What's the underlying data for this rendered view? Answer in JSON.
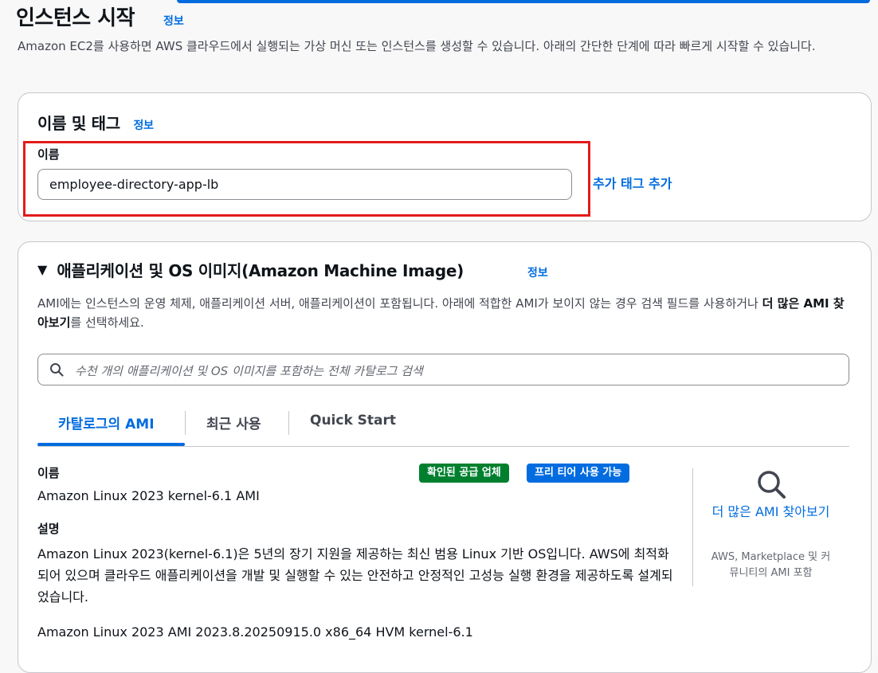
{
  "page": {
    "title": "인스턴스 시작",
    "info": "정보",
    "description": "Amazon EC2를 사용하면 AWS 클라우드에서 실행되는 가상 머신 또는 인스턴스를 생성할 수 있습니다. 아래의 간단한 단계에 따라 빠르게 시작할 수 있습니다."
  },
  "name_tags": {
    "heading": "이름 및 태그",
    "info": "정보",
    "name_label": "이름",
    "name_value": "employee-directory-app-lb",
    "add_tags": "추가 태그 추가"
  },
  "ami": {
    "heading": "애플리케이션 및 OS 이미지(Amazon Machine Image)",
    "info": "정보",
    "desc_part1": "AMI에는 인스턴스의 운영 체제, 애플리케이션 서버, 애플리케이션이 포함됩니다. 아래에 적합한 AMI가 보이지 않는 경우 검색 필드를 사용하거나 ",
    "desc_bold": "더 많은 AMI 찾아보기",
    "desc_part2": "를 선택하세요.",
    "search_placeholder": "수천 개의 애플리케이션 및 OS 이미지를 포함하는 전체 카탈로그 검색",
    "tabs": [
      "카탈로그의 AMI",
      "최근 사용",
      "Quick Start"
    ],
    "name_label": "이름",
    "name_value": "Amazon Linux 2023 kernel-6.1 AMI",
    "badges": [
      "확인된 공급 업체",
      "프리 티어 사용 가능"
    ],
    "desc_label": "설명",
    "desc_value": "Amazon Linux 2023(kernel-6.1)은 5년의 장기 지원을 제공하는 최신 범용 Linux 기반 OS입니다. AWS에 최적화되어 있으며 클라우드 애플리케이션을 개발 및 실행할 수 있는 안전하고 안정적인 고성능 실행 환경을 제공하도록 설계되었습니다.",
    "ami_version": "Amazon Linux 2023 AMI 2023.8.20250915.0 x86_64 HVM kernel-6.1",
    "browse_more": "더 많은 AMI 찾아보기",
    "browse_more_sub": "AWS, Marketplace 및 커뮤니티의 AMI 포함"
  },
  "colors": {
    "accent": "#006ce0",
    "highlight": "#e21b1b",
    "badge_green": "#00802f"
  },
  "icons": [
    "search-icon",
    "triangle-down-icon",
    "magnifier-icon"
  ]
}
